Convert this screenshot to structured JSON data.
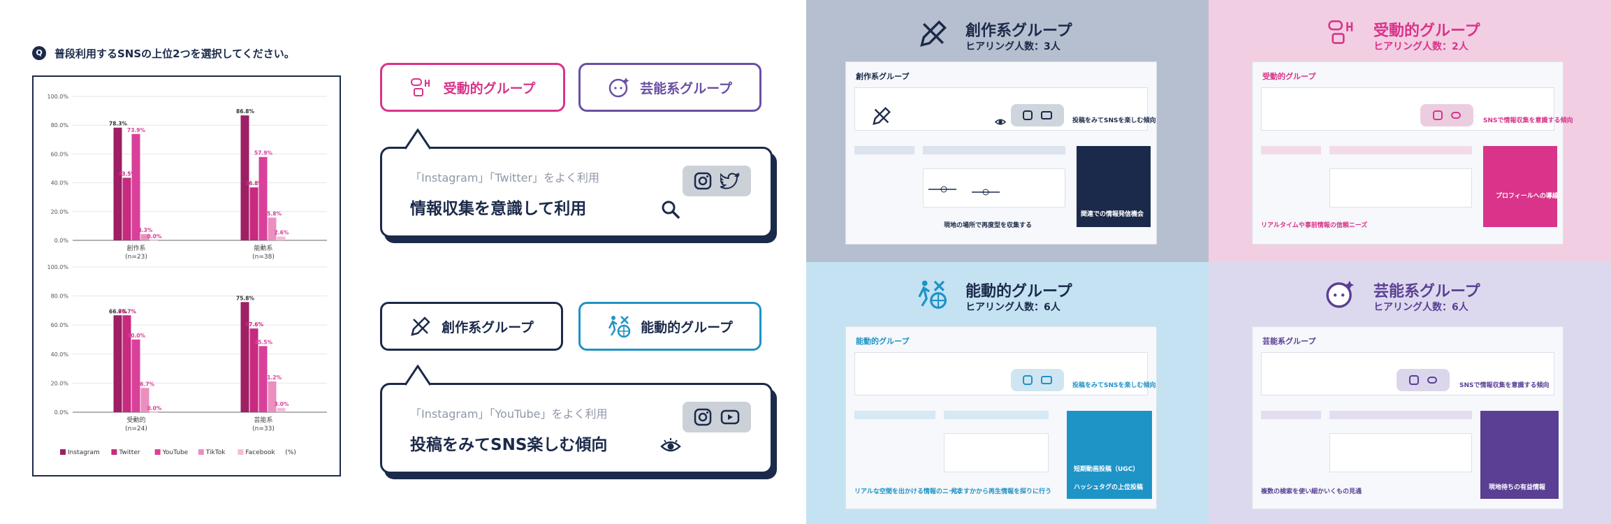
{
  "question": {
    "badge": "Q",
    "text": "普段利用するSNSの上位2つを選択してください。"
  },
  "chart_data": [
    {
      "type": "bar",
      "categories": [
        "創作系\n(n=23)",
        "能動系\n(n=38)"
      ],
      "ylim": [
        0,
        100
      ],
      "yticks": [
        "0.0%",
        "20.0%",
        "40.0%",
        "60.0%",
        "80.0%",
        "100.0%"
      ],
      "series": [
        {
          "name": "Instagram",
          "values": [
            78.3,
            86.8
          ]
        },
        {
          "name": "Twitter",
          "values": [
            43.5,
            36.8
          ]
        },
        {
          "name": "YouTube",
          "values": [
            73.9,
            57.9
          ]
        },
        {
          "name": "TikTok",
          "values": [
            4.3,
            15.8
          ]
        },
        {
          "name": "Facebook",
          "values": [
            0.0,
            2.6
          ]
        }
      ]
    },
    {
      "type": "bar",
      "categories": [
        "受動的\n(n=24)",
        "芸能系\n(n=33)"
      ],
      "ylim": [
        0,
        100
      ],
      "yticks": [
        "0.0%",
        "20.0%",
        "40.0%",
        "60.0%",
        "80.0%",
        "100.0%"
      ],
      "series": [
        {
          "name": "Instagram",
          "values": [
            66.7,
            75.8
          ]
        },
        {
          "name": "Twitter",
          "values": [
            66.7,
            57.6
          ]
        },
        {
          "name": "YouTube",
          "values": [
            50.0,
            45.5
          ]
        },
        {
          "name": "TikTok",
          "values": [
            16.7,
            21.2
          ]
        },
        {
          "name": "Facebook",
          "values": [
            0.0,
            3.0
          ]
        }
      ]
    }
  ],
  "legend_unit": "(%)",
  "colors": [
    "#9e1f63",
    "#c72a7f",
    "#d9409a",
    "#eb8fbf",
    "#f3bcd7"
  ],
  "pills": {
    "p1": "受動的グループ",
    "p2": "芸能系グループ",
    "p3": "創作系グループ",
    "p4": "能動的グループ"
  },
  "bubble1": {
    "sub": "「Instagram」「Twitter」をよく利用",
    "main": "情報収集を意識して利用"
  },
  "bubble2": {
    "sub": "「Instagram」「YouTube」をよく利用",
    "main": "投稿をみてSNS楽しむ傾向"
  },
  "quads": {
    "q1": {
      "title": "創作系グループ",
      "sub": "ヒアリング人数：3人",
      "slide_title": "創作系グループ",
      "tagline": "投稿をみてSNSを楽しむ傾向",
      "result": "関連での情報発信機会",
      "bottom": "現地の場所で再度型を収集する"
    },
    "q2": {
      "title": "受動的グループ",
      "sub": "ヒアリング人数：2人",
      "slide_title": "受動的グループ",
      "tagline": "SNSで情報収集を意識する傾向",
      "result": "プロフィールへの導線",
      "bottom": "リアルタイムや事前情報の信頼ニーズ"
    },
    "q3": {
      "title": "能動的グループ",
      "sub": "ヒアリング人数：6人",
      "slide_title": "能動的グループ",
      "tagline": "投稿をみてSNSを楽しむ傾向",
      "result": "短期動画投稿（UGC）",
      "result2": "ハッシュタグの上位投稿",
      "bottom": "見ますかから再生情報を探りに行う",
      "bottom2": "リアルな空間を出かける情報のニーズ"
    },
    "q4": {
      "title": "芸能系グループ",
      "sub": "ヒアリング人数：6人",
      "slide_title": "芸能系グループ",
      "tagline": "SNSで情報収集を意識する傾向",
      "result": "現地待ちの有益情報",
      "bottom": "複数の検索を使い細かいくもの見通"
    }
  }
}
